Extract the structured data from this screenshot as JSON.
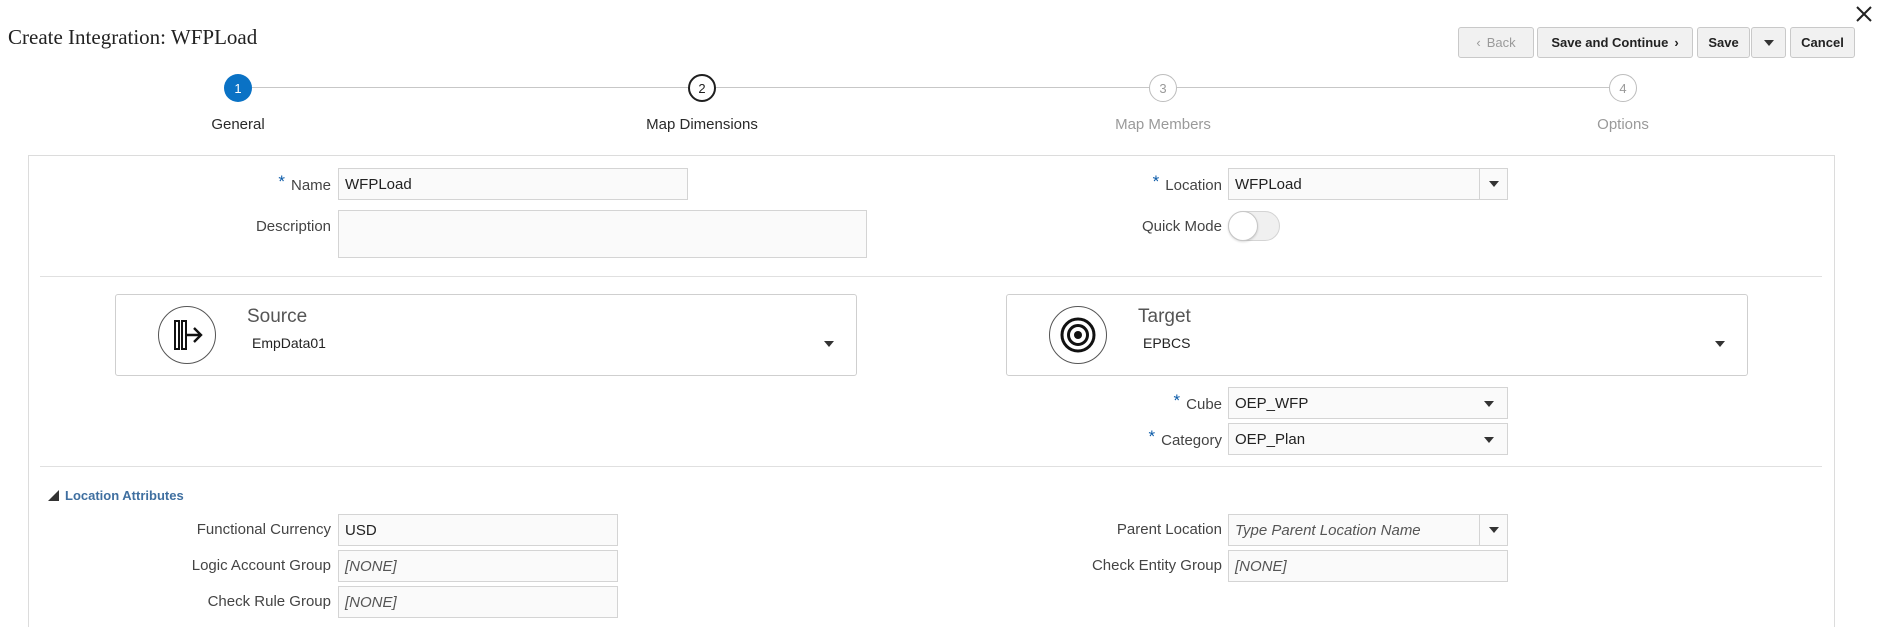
{
  "page": {
    "title": "Create Integration: WFPLoad"
  },
  "toolbar": {
    "back_label": "Back",
    "save_continue_label": "Save and Continue",
    "save_label": "Save",
    "cancel_label": "Cancel"
  },
  "steps": [
    {
      "number": "1",
      "label": "General",
      "state": "complete"
    },
    {
      "number": "2",
      "label": "Map Dimensions",
      "state": "current"
    },
    {
      "number": "3",
      "label": "Map Members",
      "state": "pending"
    },
    {
      "number": "4",
      "label": "Options",
      "state": "pending"
    }
  ],
  "general": {
    "name_label": "Name",
    "name_value": "WFPLoad",
    "description_label": "Description",
    "description_value": "",
    "location_label": "Location",
    "location_value": "WFPLoad",
    "quick_mode_label": "Quick Mode",
    "quick_mode_on": false
  },
  "source": {
    "title": "Source",
    "value": "EmpData01",
    "icon": "source-arrow-icon"
  },
  "target": {
    "title": "Target",
    "value": "EPBCS",
    "icon": "target-icon",
    "cube_label": "Cube",
    "cube_value": "OEP_WFP",
    "category_label": "Category",
    "category_value": "OEP_Plan"
  },
  "location_attributes": {
    "title": "Location Attributes",
    "functional_currency_label": "Functional Currency",
    "functional_currency_value": "USD",
    "logic_account_group_label": "Logic Account Group",
    "logic_account_group_value": "[NONE]",
    "check_rule_group_label": "Check Rule Group",
    "check_rule_group_value": "[NONE]",
    "parent_location_label": "Parent Location",
    "parent_location_placeholder": "Type Parent Location Name",
    "check_entity_group_label": "Check Entity Group",
    "check_entity_group_value": "[NONE]"
  },
  "colors": {
    "accent": "#0a72c5",
    "required": "#0a5aa8",
    "link": "#3f6fa0"
  }
}
